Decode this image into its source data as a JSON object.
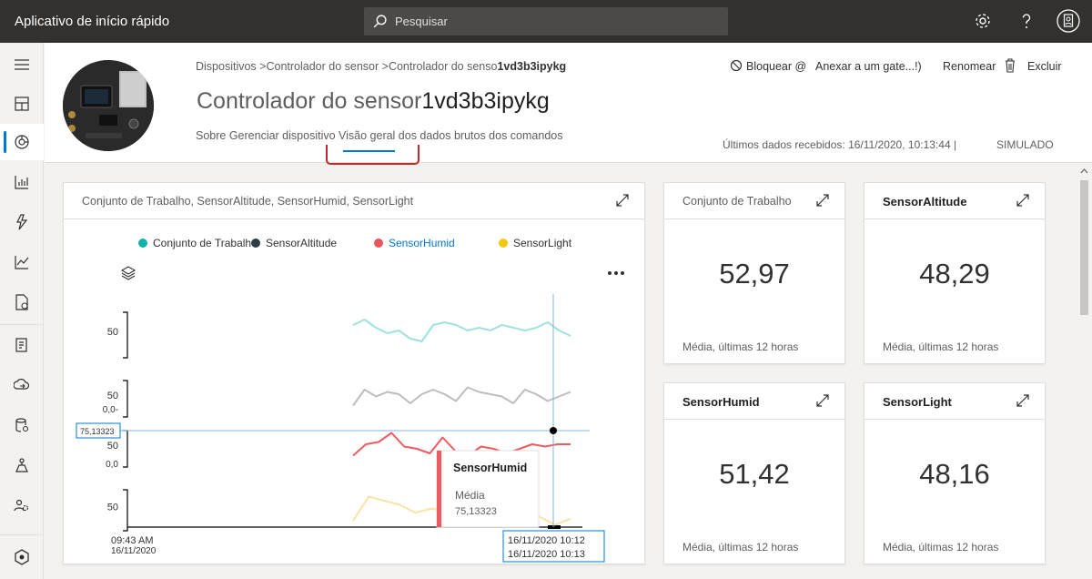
{
  "topbar": {
    "app_title": "Aplicativo de início rápido",
    "search_placeholder": "Pesquisar",
    "icons": [
      "settings-icon",
      "help-icon",
      "account-icon"
    ]
  },
  "rail": {
    "items": [
      "menu-icon",
      "dashboard-icon",
      "devices-icon",
      "device-groups-icon",
      "rules-icon",
      "analytics-icon",
      "jobs-icon",
      "device-templates-icon",
      "data-export-icon",
      "file-upload-icon",
      "permissions-icon",
      "administration-icon",
      "iot-central-icon"
    ]
  },
  "header": {
    "breadcrumb": {
      "part1": "Dispositivos >",
      "part2": "Controlador do sensor >",
      "part3_prefix": "Controlador do senso",
      "part3_id": "1vd3b3ipykg"
    },
    "title_prefix": "Controlador do sensor",
    "title_id": "1vd3b3ipykg",
    "tabs": "Sobre Gerenciar dispositivo Visão geral dos dados brutos dos comandos",
    "commands": {
      "block": "Bloquear @",
      "attach": "Anexar a um gate...!)",
      "rename": "Renomear",
      "delete": "Excluir"
    },
    "last_data": "Últimos dados recebidos: 16/11/2020, 10:13:44 |",
    "simulated": "SIMULADO"
  },
  "chart_card": {
    "title": "Conjunto de Trabalho, SensorAltitude, SensorHumid, SensorLight",
    "legend": [
      {
        "name": "Conjunto de Trabalh",
        "color": "#12b3a8"
      },
      {
        "name": "SensorAltitude",
        "color": "#2d3e46"
      },
      {
        "name": "SensorHumid",
        "color": "#e8555a"
      },
      {
        "name": "SensorLight",
        "color": "#f2c811"
      }
    ],
    "tooltip": {
      "title": "SensorHumid",
      "label": "Média",
      "value": "75,13323"
    },
    "cursor_value": "75,13323",
    "y_ticks": [
      "50",
      "50",
      "0,0-",
      "50",
      "0,0",
      "50"
    ],
    "x_start_time": "09:43 AM",
    "x_start_date": "16/11/2020",
    "x_range_1": "16/11/2020 10:12",
    "x_range_2": "16/11/2020 10:13"
  },
  "chart_data": {
    "type": "line",
    "series": [
      {
        "name": "Conjunto de Trabalh",
        "values": [
          52,
          54,
          51,
          49,
          50,
          47,
          46,
          52,
          53,
          52,
          50,
          51,
          50,
          52,
          51,
          50,
          51,
          53,
          50,
          48
        ]
      },
      {
        "name": "SensorAltitude",
        "values": [
          45,
          52,
          49,
          51,
          50,
          46,
          50,
          52,
          50,
          47,
          53,
          51,
          50,
          49,
          46,
          52,
          50,
          47,
          49,
          51
        ]
      },
      {
        "name": "SensorHumid",
        "values": [
          70,
          75,
          76,
          80,
          74,
          73,
          71,
          78,
          72,
          70,
          74,
          73,
          71,
          73,
          75,
          74,
          75,
          75
        ]
      },
      {
        "name": "SensorLight",
        "values": [
          40,
          52,
          50,
          48,
          44,
          46,
          45,
          48,
          46,
          44,
          40,
          50,
          42,
          38,
          41
        ]
      }
    ]
  },
  "kpis": [
    {
      "title": "Conjunto de Trabalho",
      "value": "52,97",
      "sub": "Média, últimas 12 horas"
    },
    {
      "title": "SensorAltitude",
      "value": "48,29",
      "sub": "Média, últimas 12 horas"
    },
    {
      "title": "SensorHumid",
      "value": "51,42",
      "sub": "Média, últimas 12 horas"
    },
    {
      "title": "SensorLight",
      "value": "48,16",
      "sub": "Média, últimas 12 horas"
    }
  ]
}
